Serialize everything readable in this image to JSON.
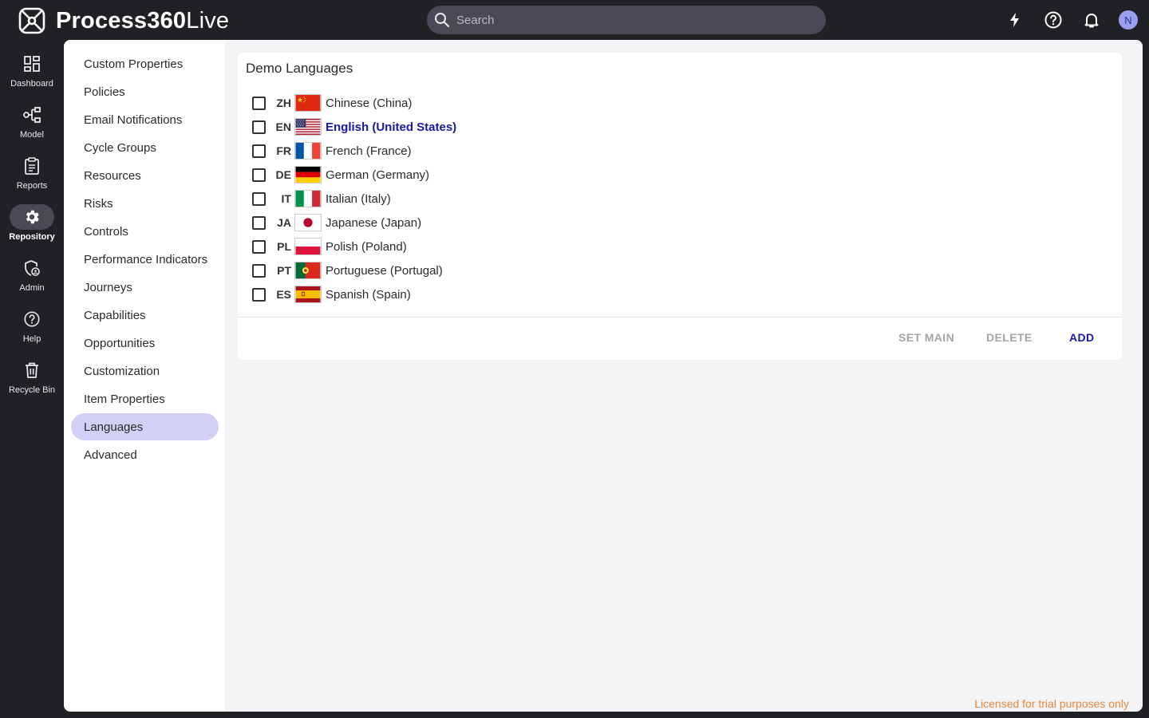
{
  "app": {
    "name_bold": "Process360",
    "name_light": "Live"
  },
  "search": {
    "placeholder": "Search"
  },
  "user": {
    "initial": "N"
  },
  "rail": [
    {
      "label": "Dashboard",
      "icon": "dashboard-icon"
    },
    {
      "label": "Model",
      "icon": "model-icon"
    },
    {
      "label": "Reports",
      "icon": "reports-icon"
    },
    {
      "label": "Repository",
      "icon": "gear-icon",
      "active": true
    },
    {
      "label": "Admin",
      "icon": "admin-shield-icon"
    },
    {
      "label": "Help",
      "icon": "help-icon"
    },
    {
      "label": "Recycle Bin",
      "icon": "trash-icon"
    }
  ],
  "subnav": [
    "Custom Properties",
    "Policies",
    "Email Notifications",
    "Cycle Groups",
    "Resources",
    "Risks",
    "Controls",
    "Performance Indicators",
    "Journeys",
    "Capabilities",
    "Opportunities",
    "Customization",
    "Item Properties",
    "Languages",
    "Advanced"
  ],
  "subnav_active": "Languages",
  "card": {
    "title": "Demo Languages",
    "languages": [
      {
        "code": "ZH",
        "name": "Chinese (China)",
        "flag": "cn-flag-icon"
      },
      {
        "code": "EN",
        "name": "English (United States)",
        "flag": "us-flag-icon",
        "main": true
      },
      {
        "code": "FR",
        "name": "French (France)",
        "flag": "fr-flag-icon"
      },
      {
        "code": "DE",
        "name": "German (Germany)",
        "flag": "de-flag-icon"
      },
      {
        "code": "IT",
        "name": "Italian (Italy)",
        "flag": "it-flag-icon"
      },
      {
        "code": "JA",
        "name": "Japanese (Japan)",
        "flag": "jp-flag-icon"
      },
      {
        "code": "PL",
        "name": "Polish (Poland)",
        "flag": "pl-flag-icon"
      },
      {
        "code": "PT",
        "name": "Portuguese (Portugal)",
        "flag": "pt-flag-icon"
      },
      {
        "code": "ES",
        "name": "Spanish (Spain)",
        "flag": "es-flag-icon"
      }
    ],
    "actions": {
      "set_main": "SET MAIN",
      "delete": "DELETE",
      "add": "ADD"
    }
  },
  "footer": {
    "license": "Licensed for trial purposes only"
  },
  "colors": {
    "accent": "#1a17a8",
    "selected_nav": "#d1d0f5",
    "license": "#e8873a",
    "dark_bg": "#202124"
  }
}
